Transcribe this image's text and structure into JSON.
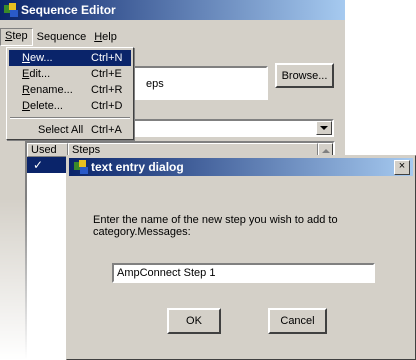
{
  "window": {
    "title": "Sequence Editor"
  },
  "menubar": {
    "items": [
      {
        "label": "Step",
        "mnemonic": "S",
        "rest": "tep"
      },
      {
        "label": "Sequence",
        "mnemonic": "",
        "rest": "Sequence"
      },
      {
        "label": "Help",
        "mnemonic": "H",
        "rest": "elp"
      }
    ]
  },
  "step_menu": {
    "items": [
      {
        "mn": "N",
        "rest": "ew...",
        "shortcut": "Ctrl+N",
        "highlighted": true
      },
      {
        "mn": "E",
        "rest": "dit...",
        "shortcut": "Ctrl+E"
      },
      {
        "mn": "R",
        "rest": "ename...",
        "shortcut": "Ctrl+R"
      },
      {
        "mn": "D",
        "rest": "elete...",
        "shortcut": "Ctrl+D"
      },
      {
        "mn": "",
        "rest": "Select All",
        "shortcut": "Ctrl+A"
      }
    ]
  },
  "main": {
    "steps_field_text": "eps",
    "browse_label": "Browse...",
    "list": {
      "col_used": "Used",
      "col_steps": "Steps",
      "row_check": "✓"
    }
  },
  "dialog": {
    "title": "text entry dialog",
    "close_glyph": "×",
    "prompt_line1": "Enter the name of the new step you wish to add to",
    "prompt_line2": "category.Messages:",
    "input_value": "AmpConnect Step 1",
    "ok_label": "OK",
    "cancel_label": "Cancel"
  },
  "colors": {
    "title_active": "#0a246a",
    "title_gradient_end": "#a6caf0",
    "face": "#d4d0c8",
    "highlight": "#0a246a"
  }
}
